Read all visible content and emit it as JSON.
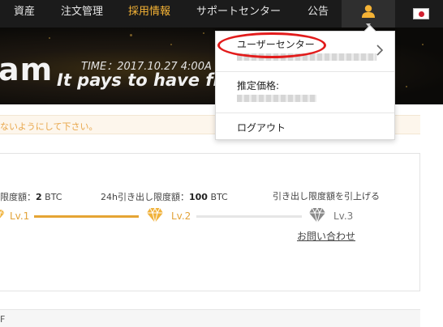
{
  "nav": {
    "items": [
      {
        "label": "資産",
        "active": false
      },
      {
        "label": "注文管理",
        "active": false
      },
      {
        "label": "採用情報",
        "active": true
      },
      {
        "label": "サポートセンター",
        "active": false
      },
      {
        "label": "公告",
        "active": false
      }
    ],
    "user_icon": "user-icon",
    "flag_icon": "japan-flag-icon",
    "accent_color": "#f5b335"
  },
  "banner": {
    "title_fragment": "am",
    "time_text": "TIME：2017.10.27 4:00A",
    "tagline": "It pays to have fri"
  },
  "notice": {
    "text": "ないようにして下さい。"
  },
  "limits": {
    "lv1_label": "限度額：",
    "lv1_value": "2",
    "lv1_unit": "BTC",
    "lv2_label": "24h引き出し限度額：",
    "lv2_value": "100",
    "lv2_unit": "BTC",
    "raise_label": "引き出し限度額を引上げる",
    "levels": [
      "Lv.1",
      "Lv.2",
      "Lv.3"
    ],
    "contact_link": "お問い合わせ",
    "gold_color": "#e5a534"
  },
  "bottom": {
    "text": "F"
  },
  "dropdown": {
    "user_center_label": "ユーザーセンター",
    "estimated_value_label": "推定価格:",
    "logout_label": "ログアウト",
    "highlight_color": "#e21b1b"
  }
}
